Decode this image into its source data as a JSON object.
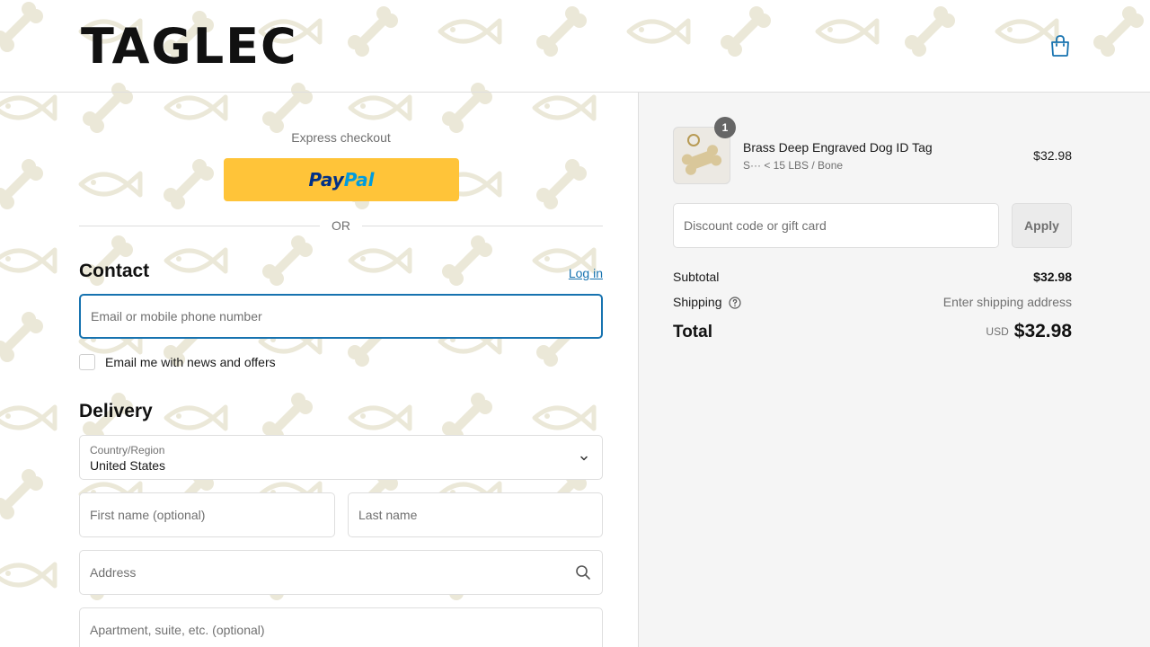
{
  "brand": {
    "logo_text": "TAGLEC"
  },
  "header": {
    "cart_icon": "shopping-bag-icon"
  },
  "express": {
    "label": "Express checkout",
    "paypal_text_a": "Pay",
    "paypal_text_b": "Pal"
  },
  "divider": {
    "or_text": "OR"
  },
  "contact": {
    "title": "Contact",
    "login_label": "Log in",
    "email_placeholder": "Email or mobile phone number",
    "newsletter_label": "Email me with news and offers"
  },
  "delivery": {
    "title": "Delivery",
    "country_label": "Country/Region",
    "country_value": "United States",
    "first_name_placeholder": "First name (optional)",
    "last_name_placeholder": "Last name",
    "address_placeholder": "Address",
    "apartment_placeholder": "Apartment, suite, etc. (optional)"
  },
  "order": {
    "item": {
      "quantity": "1",
      "name": "Brass Deep Engraved Dog ID Tag",
      "variant": "S··· < 15 LBS / Bone",
      "price": "$32.98"
    },
    "discount_placeholder": "Discount code or gift card",
    "apply_label": "Apply",
    "subtotal_label": "Subtotal",
    "subtotal_value": "$32.98",
    "shipping_label": "Shipping",
    "shipping_value": "Enter shipping address",
    "total_label": "Total",
    "currency": "USD",
    "total_value": "$32.98"
  },
  "colors": {
    "accent": "#1773b0",
    "paypal_yellow": "#ffc439",
    "panel_bg": "#f5f5f5"
  }
}
